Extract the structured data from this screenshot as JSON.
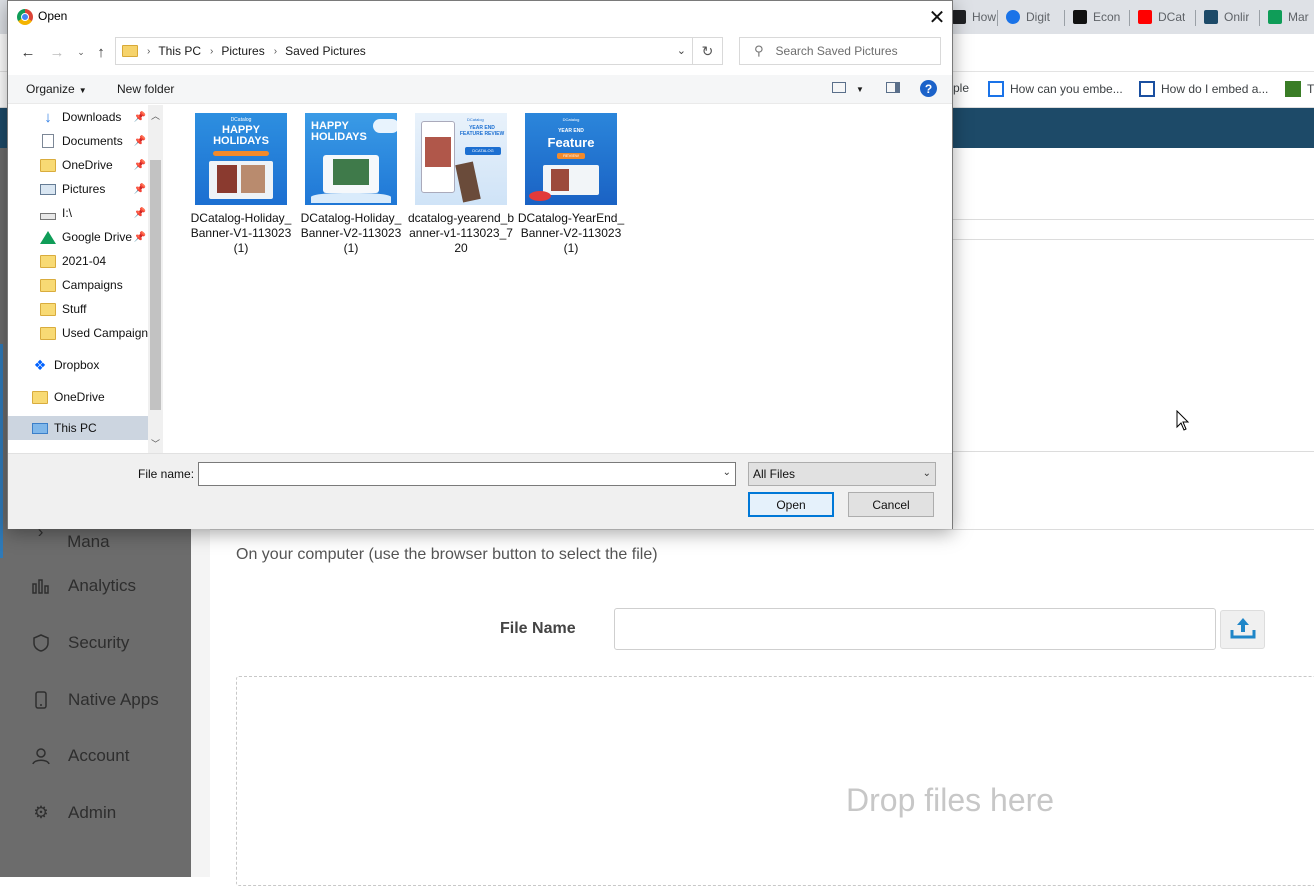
{
  "browser": {
    "tabs": [
      {
        "label": "How",
        "color": "#202124"
      },
      {
        "label": "Digit",
        "color": "#1a73e8"
      },
      {
        "label": "Econ",
        "color": "#111111"
      },
      {
        "label": "DCat",
        "color": "#ff0000"
      },
      {
        "label": "Onlir",
        "color": "#1d4a68"
      },
      {
        "label": "Mar",
        "color": "#0f9d58"
      }
    ],
    "bookmarks": [
      {
        "label": "ple"
      },
      {
        "label": "How can you embe..."
      },
      {
        "label": "How do I embed a..."
      },
      {
        "label": "T"
      }
    ]
  },
  "app": {
    "sidebar": {
      "items": [
        {
          "label": "Multimedia Mana",
          "icon": "chevron-right-icon"
        },
        {
          "label": "Analytics",
          "icon": "bar-chart-icon"
        },
        {
          "label": "Security",
          "icon": "shield-icon"
        },
        {
          "label": "Native Apps",
          "icon": "phone-icon"
        },
        {
          "label": "Account",
          "icon": "user-icon"
        },
        {
          "label": "Admin",
          "icon": "gear-icon"
        }
      ]
    },
    "upload": {
      "description": "On your computer (use the browser button to select the file)",
      "file_name_label": "File Name",
      "drop_text": "Drop files here"
    }
  },
  "dialog": {
    "title": "Open",
    "breadcrumb": [
      "This PC",
      "Pictures",
      "Saved Pictures"
    ],
    "search_placeholder": "Search Saved Pictures",
    "toolbar": {
      "organize": "Organize",
      "new_folder": "New folder",
      "help": "?"
    },
    "nav_items": [
      {
        "label": "Downloads",
        "icon": "download-icon",
        "pinned": true
      },
      {
        "label": "Documents",
        "icon": "document-icon",
        "pinned": true
      },
      {
        "label": "OneDrive",
        "icon": "folder-icon",
        "pinned": true
      },
      {
        "label": "Pictures",
        "icon": "pictures-icon",
        "pinned": true
      },
      {
        "label": "I:\\",
        "icon": "drive-icon",
        "pinned": true
      },
      {
        "label": "Google Drive",
        "icon": "google-drive-icon",
        "pinned": true
      },
      {
        "label": "2021-04",
        "icon": "folder-icon",
        "pinned": false
      },
      {
        "label": "Campaigns",
        "icon": "folder-icon",
        "pinned": false
      },
      {
        "label": "Stuff",
        "icon": "folder-icon",
        "pinned": false
      },
      {
        "label": "Used Campaigns",
        "icon": "folder-icon",
        "pinned": false
      },
      {
        "label": "Dropbox",
        "icon": "dropbox-icon",
        "pinned": false
      },
      {
        "label": "OneDrive",
        "icon": "folder-icon",
        "pinned": false
      },
      {
        "label": "This PC",
        "icon": "computer-icon",
        "pinned": false,
        "selected": true
      }
    ],
    "files": [
      {
        "name": "DCatalog-Holiday_Banner-V1-113023 (1)",
        "thumb_text": [
          "HAPPY",
          "HOLIDAYS"
        ],
        "brand": "DCatalog"
      },
      {
        "name": "DCatalog-Holiday_Banner-V2-113023 (1)",
        "thumb_text": [
          "HAPPY",
          "HOLIDAYS"
        ],
        "brand": ""
      },
      {
        "name": "dcatalog-yearend_banner-v1-113023_720",
        "thumb_text": [
          "YEAR END",
          "FEATURE REVIEW",
          "DCATALOG"
        ],
        "brand": "DCatalog"
      },
      {
        "name": "DCatalog-YearEnd_Banner-V2-113023 (1)",
        "thumb_text": [
          "YEAR END",
          "Feature",
          "REVIEW"
        ],
        "brand": "DCatalog"
      }
    ],
    "file_name_label": "File name:",
    "file_name_value": "",
    "filter": "All Files",
    "open_label": "Open",
    "cancel_label": "Cancel"
  }
}
